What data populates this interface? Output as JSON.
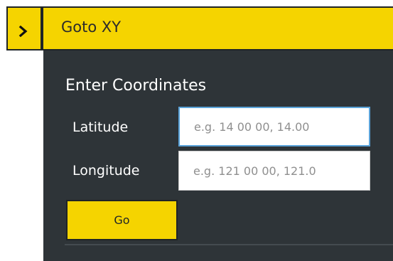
{
  "header": {
    "toggle_icon": "chevron-right-icon",
    "title": "Goto XY"
  },
  "form": {
    "section_title": "Enter Coordinates",
    "latitude": {
      "label": "Latitude",
      "placeholder": "e.g. 14 00 00, 14.00",
      "value": ""
    },
    "longitude": {
      "label": "Longitude",
      "placeholder": "e.g. 121 00 00, 121.0",
      "value": ""
    },
    "go_label": "Go"
  },
  "colors": {
    "accent": "#f5d400",
    "panel": "#2e3438",
    "focus_border": "#5aa3d9"
  }
}
